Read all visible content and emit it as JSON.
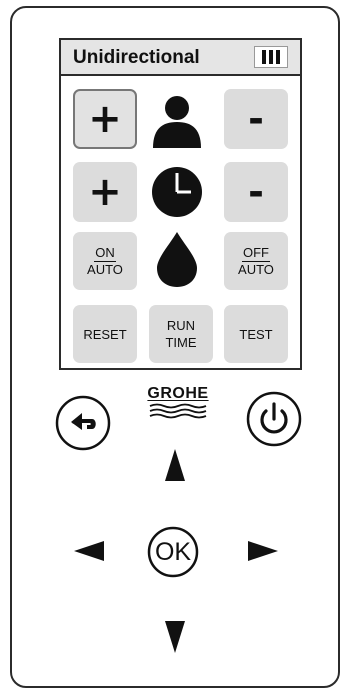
{
  "screen": {
    "title": "Unidirectional",
    "battery_icon": "battery-full-icon",
    "rows": {
      "user": {
        "plus_label": "+",
        "icon": "user-icon",
        "minus_label": "-"
      },
      "timer": {
        "plus_label": "+",
        "icon": "clock-icon",
        "minus_label": "-"
      },
      "water": {
        "on_auto_top": "ON",
        "on_auto_bottom": "AUTO",
        "icon": "water-drop-icon",
        "off_auto_top": "OFF",
        "off_auto_bottom": "AUTO"
      },
      "bottom": {
        "reset_label": "RESET",
        "run_time_line1": "RUN",
        "run_time_line2": "TIME",
        "test_label": "TEST"
      }
    }
  },
  "hardware": {
    "brand": "GROHE",
    "ok_label": "OK",
    "back_icon": "back-arrow-icon",
    "power_icon": "power-icon",
    "nav_icons": [
      "arrow-up-icon",
      "arrow-left-icon",
      "arrow-right-icon",
      "arrow-down-icon"
    ]
  },
  "colors": {
    "button_bg": "#dcdcdc",
    "title_bar_bg": "#e5e5e5",
    "outline": "#2b2b2b"
  }
}
